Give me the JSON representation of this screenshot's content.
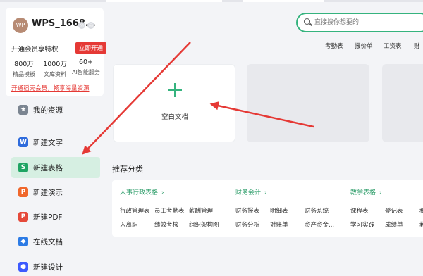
{
  "user": {
    "avatar_text": "WP",
    "name": "WPS_1668...",
    "vip_text": "开通会员享特权",
    "vip_button": "立即开通",
    "stats": [
      {
        "value": "800万",
        "label": "精品模板"
      },
      {
        "value": "1000万",
        "label": "文库资料"
      },
      {
        "value": "60+",
        "label": "AI智能服务"
      }
    ],
    "promo": "开通稻壳会员，畅享海量资源"
  },
  "nav": [
    {
      "label": "我的资源",
      "icon": "star-box-icon",
      "color": "#7b8591",
      "glyph": "★"
    },
    {
      "label": "新建文字",
      "icon": "word-doc-icon",
      "color": "#2e6bdc",
      "glyph": "W"
    },
    {
      "label": "新建表格",
      "icon": "spreadsheet-icon",
      "color": "#1fa463",
      "glyph": "S",
      "active": true
    },
    {
      "label": "新建演示",
      "icon": "presentation-icon",
      "color": "#f0672b",
      "glyph": "P"
    },
    {
      "label": "新建PDF",
      "icon": "pdf-icon",
      "color": "#e5493a",
      "glyph": "P"
    },
    {
      "label": "在线文档",
      "icon": "online-doc-icon",
      "color": "#2c7be5",
      "glyph": "◆"
    },
    {
      "label": "新建设计",
      "icon": "design-icon",
      "color": "#3d5afe",
      "glyph": "●"
    }
  ],
  "search": {
    "placeholder": "直接搜你想要的"
  },
  "search_hints": [
    "考勤表",
    "报价单",
    "工资表",
    "财"
  ],
  "blank_doc_label": "空白文档",
  "recommend_title": "推荐分类",
  "categories": [
    {
      "title": "人事行政表格",
      "items": [
        "行政管理表",
        "员工考勤表",
        "薪酬管理",
        "入离职",
        "绩效考核",
        "组织架构图"
      ]
    },
    {
      "title": "财务会计",
      "items": [
        "财务报表",
        "明细表",
        "财务系统",
        "财务分析",
        "对账单",
        "资产资金..."
      ]
    },
    {
      "title": "教学表格",
      "items": [
        "课程表",
        "登记表",
        "积",
        "学习实践",
        "成绩单",
        "教"
      ]
    }
  ],
  "colors": {
    "accent": "#35b37e",
    "arrow": "#e53935",
    "active_bg": "#d6efe2"
  }
}
